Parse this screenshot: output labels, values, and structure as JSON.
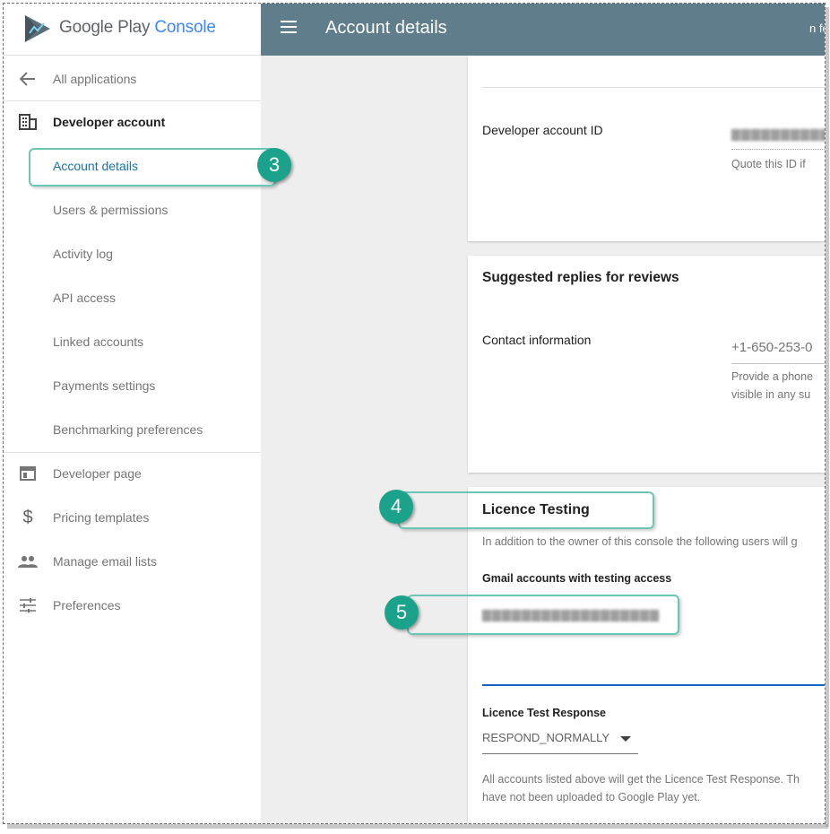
{
  "app": {
    "logo_name": "Google Play",
    "logo_product": "Console",
    "page_title": "Account details",
    "top_right_fragment": "n fo",
    "brand_colors": {
      "header": "#607d8b",
      "active_link": "#1a73a8",
      "accent": "#4285f4",
      "annotation": "#1aa38a"
    }
  },
  "sidebar": {
    "back_item": {
      "label": "All applications",
      "icon": "arrow-back-icon"
    },
    "section": {
      "label": "Developer account",
      "icon": "building-icon"
    },
    "sub_items": [
      {
        "label": "Account details",
        "active": true
      },
      {
        "label": "Users & permissions"
      },
      {
        "label": "Activity log"
      },
      {
        "label": "API access"
      },
      {
        "label": "Linked accounts"
      },
      {
        "label": "Payments settings"
      },
      {
        "label": "Benchmarking preferences"
      }
    ],
    "bottom_items": [
      {
        "label": "Developer page",
        "icon": "web-page-icon"
      },
      {
        "label": "Pricing templates",
        "icon": "dollar-icon"
      },
      {
        "label": "Manage email lists",
        "icon": "people-icon"
      },
      {
        "label": "Preferences",
        "icon": "tune-icon"
      }
    ]
  },
  "account": {
    "id_label": "Developer account ID",
    "id_value_obscured": "▇▇▇▇▇▇▇▇▇▇▇",
    "id_help": "Quote this ID if"
  },
  "replies": {
    "title": "Suggested replies for reviews",
    "contact_label": "Contact information",
    "phone_value": "+1-650-253-0",
    "phone_help_line1": "Provide a phone",
    "phone_help_line2": "visible in any su"
  },
  "licence": {
    "title": "Licence Testing",
    "description": "In addition to the owner of this console the following users will g",
    "gmail_label": "Gmail accounts with testing access",
    "gmail_value_obscured": "▇▇▇▇▇▇▇▇▇▇▇▇▇▇▇▇▇▇",
    "response_label": "Licence Test Response",
    "response_value": "RESPOND_NORMALLY",
    "response_help_line1": "All accounts listed above will get the Licence Test Response. Th",
    "response_help_line2": "have not been uploaded to Google Play yet."
  },
  "annotations": {
    "step_3": "3",
    "step_4": "4",
    "step_5": "5"
  }
}
